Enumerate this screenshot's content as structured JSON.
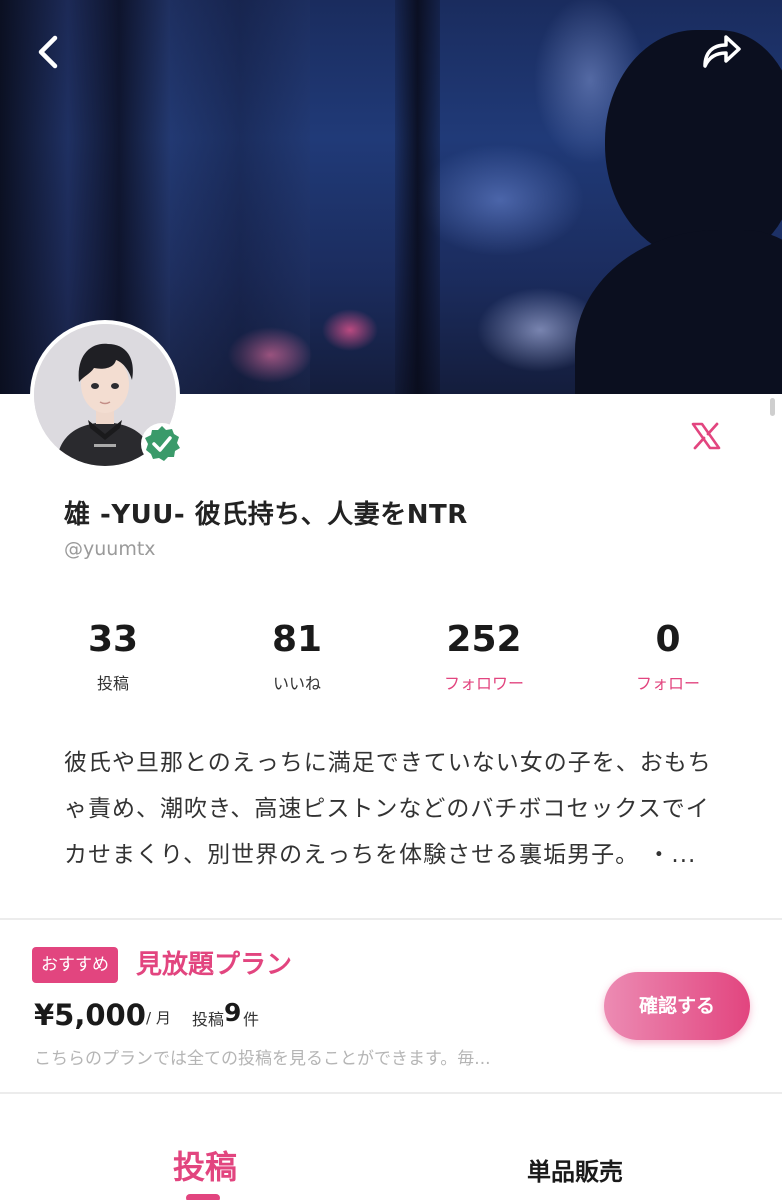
{
  "profile": {
    "name": "雄 -YUU- 彼氏持ち、人妻をNTR",
    "handle": "@yuumtx",
    "verified": true
  },
  "stats": [
    {
      "value": "33",
      "label": "投稿",
      "highlight": false
    },
    {
      "value": "81",
      "label": "いいね",
      "highlight": false
    },
    {
      "value": "252",
      "label": "フォロワー",
      "highlight": true
    },
    {
      "value": "0",
      "label": "フォロー",
      "highlight": true
    }
  ],
  "bio": {
    "line1": "彼氏や旦那とのえっちに満足できていない女の子を、おもち",
    "line2": "ゃ責め、潮吹き、高速ピストンなどのバチボコセックスでイ",
    "line3": "カせまくり、別世界のえっちを体験させる裏垢男子。 ・..."
  },
  "plan": {
    "badge": "おすすめ",
    "title": "見放題プラン",
    "price": "¥5,000",
    "per": "/ 月",
    "posts_label": "投稿",
    "posts_count": "9",
    "posts_unit": "件",
    "description": "こちらのプランでは全ての投稿を見ることができます。毎...",
    "button": "確認する"
  },
  "tabs": [
    {
      "label": "投稿",
      "active": true
    },
    {
      "label": "単品販売",
      "active": false
    }
  ],
  "colors": {
    "accent": "#e2457f",
    "verified": "#3a9a6a"
  },
  "icons": {
    "back": "chevron-left",
    "share": "share-arrow",
    "social": "x-logo",
    "verified": "check-badge"
  }
}
